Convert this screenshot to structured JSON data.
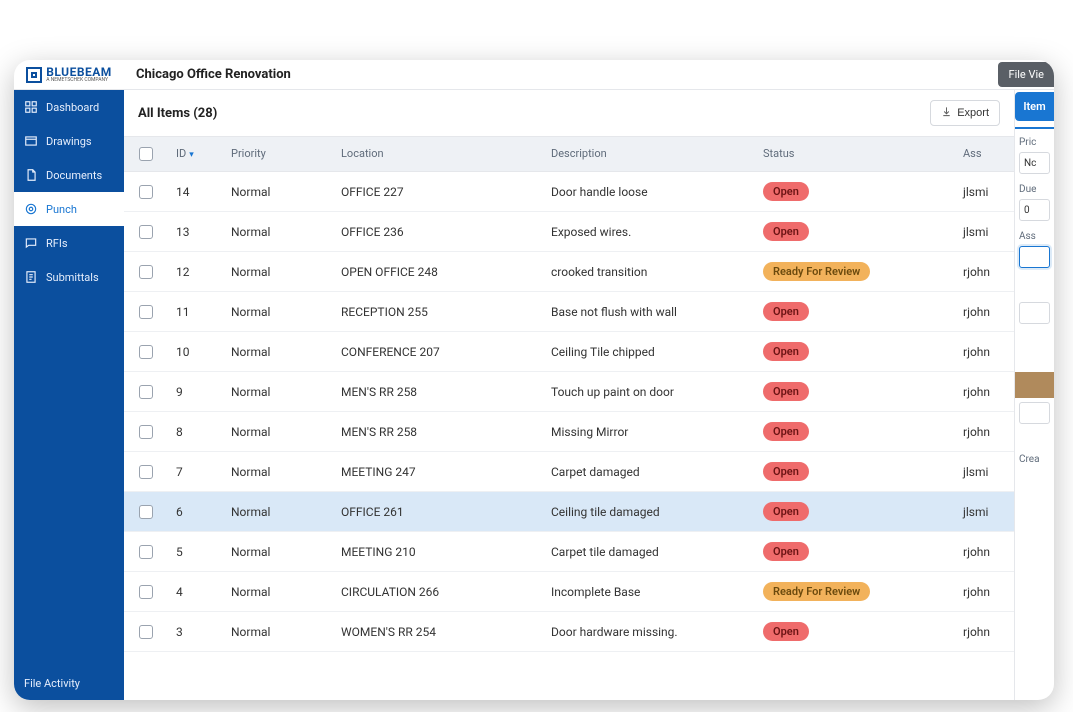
{
  "logo": {
    "text": "BLUEBEAM",
    "subtitle": "A NEMETSCHEK COMPANY"
  },
  "project_title": "Chicago Office Renovation",
  "file_view_label": "File Vie",
  "sidebar": {
    "items": [
      {
        "key": "dashboard",
        "label": "Dashboard",
        "icon": "dashboard-icon"
      },
      {
        "key": "drawings",
        "label": "Drawings",
        "icon": "drawings-icon"
      },
      {
        "key": "documents",
        "label": "Documents",
        "icon": "documents-icon"
      },
      {
        "key": "punch",
        "label": "Punch",
        "icon": "punch-icon",
        "active": true
      },
      {
        "key": "rfis",
        "label": "RFIs",
        "icon": "rfis-icon"
      },
      {
        "key": "submittals",
        "label": "Submittals",
        "icon": "submittals-icon"
      }
    ],
    "footer_label": "File Activity"
  },
  "list": {
    "title": "All Items (28)",
    "export_label": "Export",
    "columns": {
      "id": "ID",
      "priority": "Priority",
      "location": "Location",
      "description": "Description",
      "status": "Status",
      "assignee": "Ass"
    },
    "status_labels": {
      "open": "Open",
      "ready_for_review": "Ready For Review"
    },
    "rows": [
      {
        "id": "14",
        "priority": "Normal",
        "location": "OFFICE 227",
        "description": "Door handle loose",
        "status": "open",
        "assignee": "jlsmi"
      },
      {
        "id": "13",
        "priority": "Normal",
        "location": "OFFICE 236",
        "description": "Exposed wires.",
        "status": "open",
        "assignee": "jlsmi"
      },
      {
        "id": "12",
        "priority": "Normal",
        "location": "OPEN OFFICE 248",
        "description": "crooked transition",
        "status": "ready_for_review",
        "assignee": "rjohn"
      },
      {
        "id": "11",
        "priority": "Normal",
        "location": "RECEPTION 255",
        "description": "Base not flush with wall",
        "status": "open",
        "assignee": "rjohn"
      },
      {
        "id": "10",
        "priority": "Normal",
        "location": "CONFERENCE 207",
        "description": "Ceiling Tile chipped",
        "status": "open",
        "assignee": "rjohn"
      },
      {
        "id": "9",
        "priority": "Normal",
        "location": "MEN'S RR 258",
        "description": "Touch up paint on door",
        "status": "open",
        "assignee": "rjohn"
      },
      {
        "id": "8",
        "priority": "Normal",
        "location": "MEN'S RR 258",
        "description": "Missing Mirror",
        "status": "open",
        "assignee": "rjohn"
      },
      {
        "id": "7",
        "priority": "Normal",
        "location": "MEETING 247",
        "description": "Carpet damaged",
        "status": "open",
        "assignee": "jlsmi"
      },
      {
        "id": "6",
        "priority": "Normal",
        "location": "OFFICE 261",
        "description": "Ceiling tile damaged",
        "status": "open",
        "assignee": "jlsmi",
        "selected": true
      },
      {
        "id": "5",
        "priority": "Normal",
        "location": "MEETING 210",
        "description": "Carpet tile damaged",
        "status": "open",
        "assignee": "rjohn"
      },
      {
        "id": "4",
        "priority": "Normal",
        "location": "CIRCULATION 266",
        "description": "Incomplete Base",
        "status": "ready_for_review",
        "assignee": "rjohn"
      },
      {
        "id": "3",
        "priority": "Normal",
        "location": "WOMEN'S RR 254",
        "description": "Door hardware missing.",
        "status": "open",
        "assignee": "rjohn"
      }
    ]
  },
  "right_panel": {
    "tab_label": "Item",
    "priority_label": "Pric",
    "priority_value": "Nc",
    "due_label": "Due",
    "due_value": "0",
    "assignee_label": "Ass",
    "created_label": "Crea"
  }
}
